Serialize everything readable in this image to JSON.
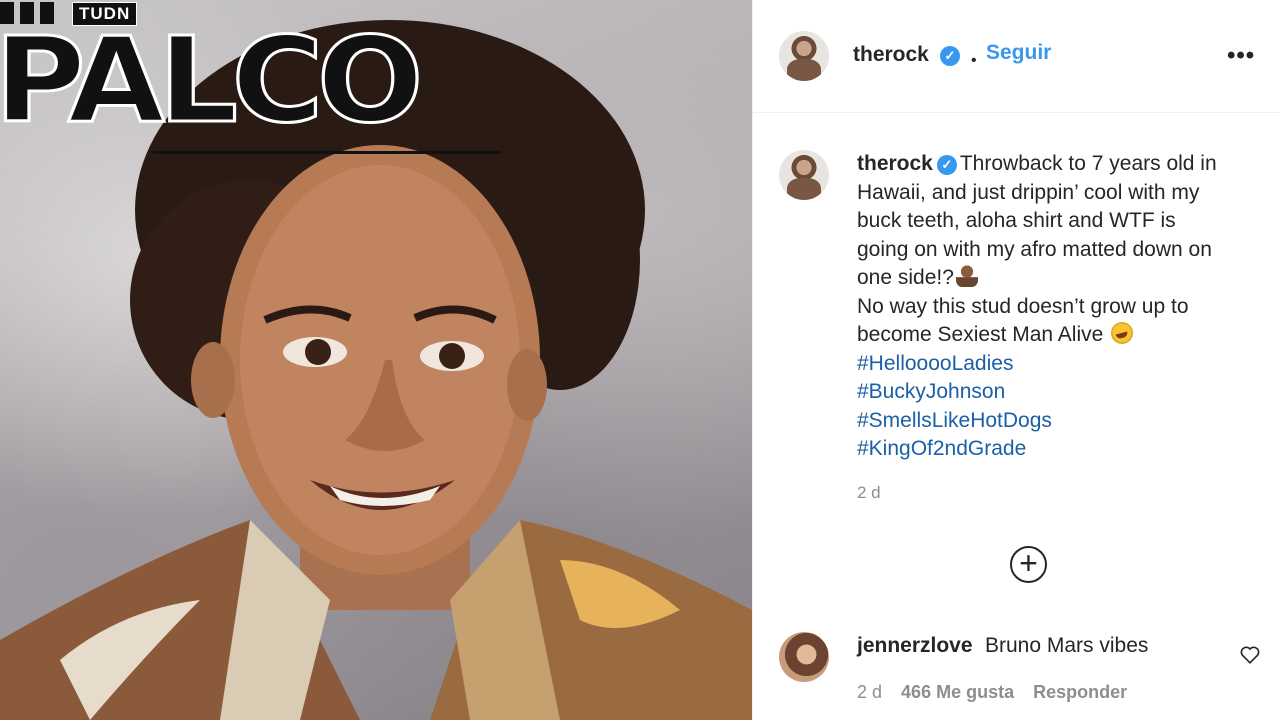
{
  "overlay": {
    "network": "TUDN",
    "headline": "PALCO"
  },
  "post": {
    "username": "therock",
    "follow_label": "Seguir",
    "dot": "•",
    "more_label": "•••",
    "caption_lines": [
      "Throwback to 7 years old in",
      "Hawaii, and just drippin’ cool with my",
      "buck teeth, aloha shirt and WTF is",
      "going on with my afro matted down on",
      "one side!?",
      "No way this stud doesn’t grow up to",
      "become Sexiest Man Alive"
    ],
    "hashtags": [
      "#HellooooLadies",
      "#BuckyJohnson",
      "#SmellsLikeHotDogs",
      "#KingOf2ndGrade"
    ],
    "age": "2 d",
    "load_more_label": "+"
  },
  "comment": {
    "username": "jennerzlove",
    "text": "Bruno Mars vibes",
    "age": "2 d",
    "likes": "466 Me gusta",
    "reply_label": "Responder"
  },
  "icons": {
    "verified": "verified-badge-icon",
    "heart": "heart-icon",
    "add": "plus-circle-icon"
  },
  "colors": {
    "link_blue": "#3897f0",
    "hashtag": "#1a5fa8",
    "muted": "#8e8e8e",
    "text": "#262626"
  }
}
